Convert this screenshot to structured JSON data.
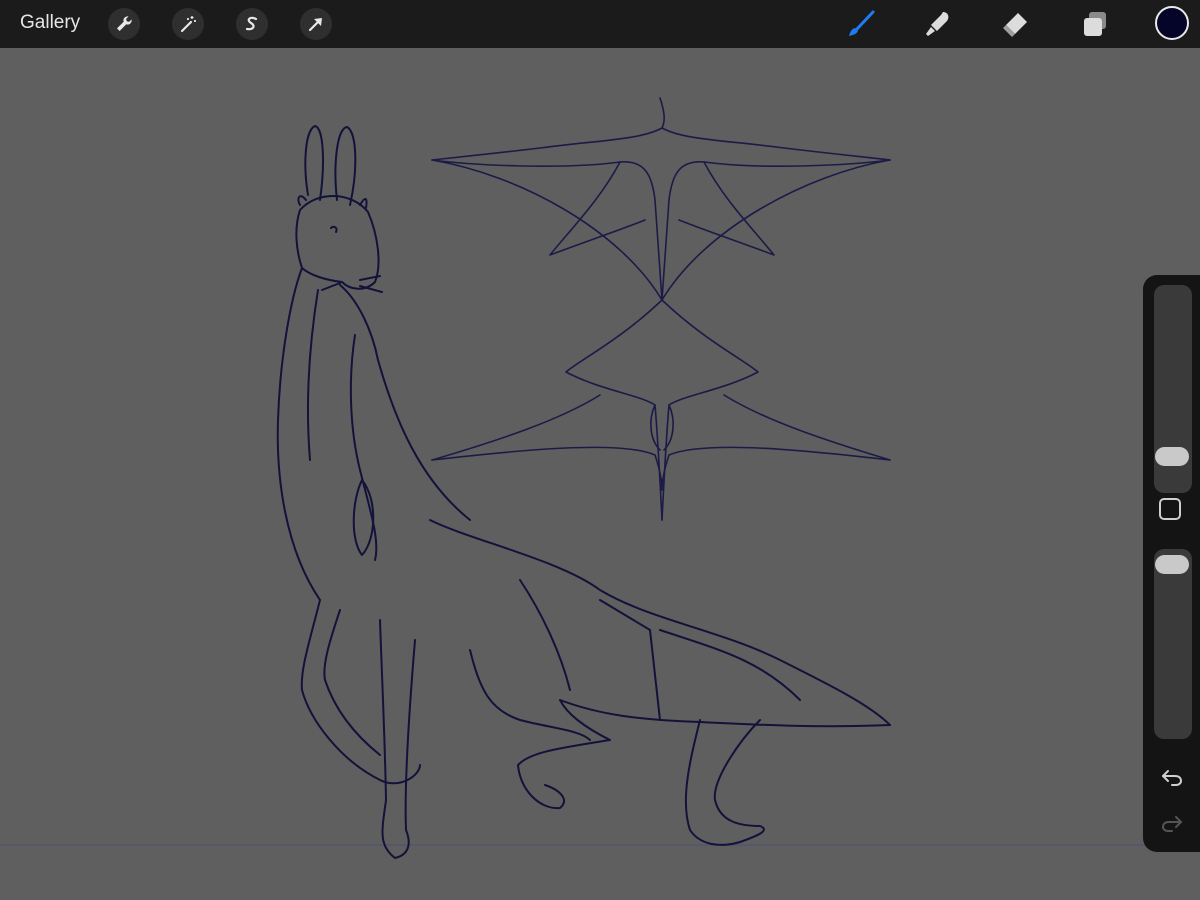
{
  "toolbar": {
    "gallery_label": "Gallery",
    "left_tools": [
      "wrench-icon",
      "magic-wand-icon",
      "selection-s-icon",
      "transform-arrow-icon"
    ],
    "right_tools": [
      "brush-icon",
      "smudge-icon",
      "eraser-icon",
      "layers-icon"
    ],
    "active_tool": "brush",
    "active_color": "#05052a",
    "accent_color": "#1e7cf2"
  },
  "sidebar": {
    "controls": [
      "brush-size-slider",
      "modify-button",
      "opacity-slider",
      "undo-icon",
      "redo-icon"
    ]
  }
}
